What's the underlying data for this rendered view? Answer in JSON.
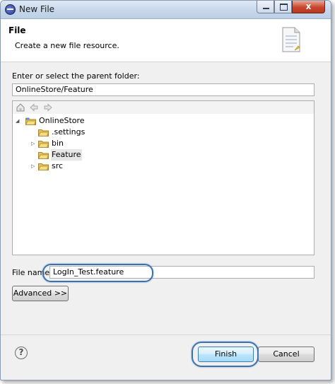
{
  "window": {
    "title": "New File",
    "close_glyph": "x",
    "icons": {
      "app": "eclipse-icon",
      "minimize": "minimize-icon",
      "maximize": "maximize-icon",
      "close": "close-icon"
    }
  },
  "header": {
    "title": "File",
    "description": "Create a new file resource.",
    "icon": "new-file-wizard-icon"
  },
  "parent_folder": {
    "label": "Enter or select the parent folder:",
    "value": "OnlineStore/Feature"
  },
  "tree_toolbar": {
    "icons": [
      "home-icon",
      "back-arrow-icon",
      "forward-arrow-icon"
    ]
  },
  "tree": {
    "project": {
      "label": "OnlineStore",
      "expanded": true
    },
    "items": [
      {
        "label": ".settings",
        "expandable": false
      },
      {
        "label": "bin",
        "expandable": true
      },
      {
        "label": "Feature",
        "expandable": false,
        "selected": true
      },
      {
        "label": "src",
        "expandable": true
      }
    ]
  },
  "file_name": {
    "label": "File name:",
    "value": "LogIn_Test.feature"
  },
  "buttons": {
    "advanced": "Advanced >>",
    "finish": "Finish",
    "cancel": "Cancel",
    "help_glyph": "?"
  },
  "colors": {
    "highlight_ring": "#3a72b0",
    "default_button": "#bee6fd"
  }
}
